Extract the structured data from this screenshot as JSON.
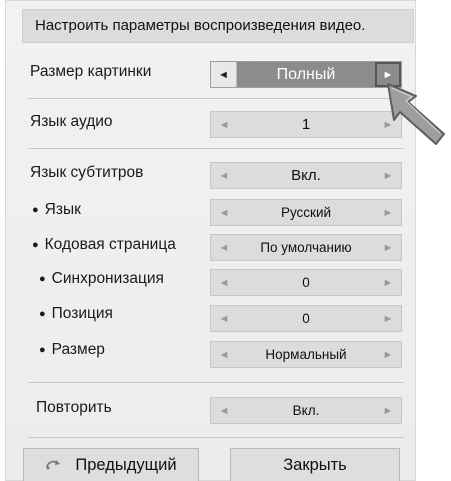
{
  "header": {
    "title": "Настроить параметры воспроизведения видео."
  },
  "rows": {
    "picture_size": {
      "label": "Размер картинки",
      "value": "Полный"
    },
    "audio_language": {
      "label": "Язык аудио",
      "value": "1"
    },
    "subtitle_language": {
      "label": "Язык субтитров",
      "value": "Вкл."
    },
    "language": {
      "label": "Язык",
      "value": "Русский"
    },
    "code_page": {
      "label": "Кодовая страница",
      "value": "По умолчанию"
    },
    "sync": {
      "label": "Синхронизация",
      "value": "0"
    },
    "position": {
      "label": "Позиция",
      "value": "0"
    },
    "size": {
      "label": "Размер",
      "value": "Нормальный"
    },
    "repeat": {
      "label": "Повторить",
      "value": "Вкл."
    }
  },
  "arrows": {
    "left": "◄",
    "right": "►"
  },
  "buttons": {
    "previous": "Предыдущий",
    "close": "Закрыть",
    "previous_icon": "return-arrow-icon"
  },
  "colors": {
    "active_selector": "#8c8c8c",
    "selector_bg": "#dcdcdc",
    "panel_bg": "#efefef"
  }
}
